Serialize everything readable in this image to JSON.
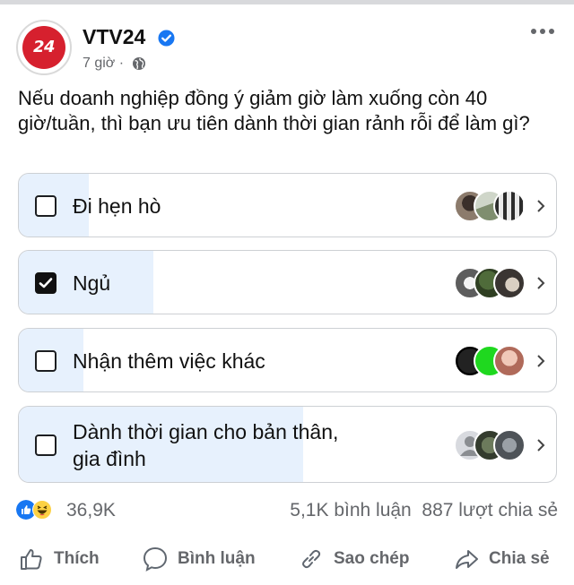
{
  "post": {
    "page_name": "VTV24",
    "avatar_label": "24",
    "time": "7 giờ",
    "separator": "·",
    "text": "Nếu doanh nghiệp đồng ý giảm giờ làm xuống còn 40 giờ/tuần, thì bạn ưu tiên dành thời gian rảnh rỗi để làm gì?"
  },
  "poll": {
    "options": [
      {
        "label": "Đi hẹn hò",
        "checked": false,
        "share": 0.13
      },
      {
        "label": "Ngủ",
        "checked": true,
        "share": 0.25
      },
      {
        "label": "Nhận thêm việc khác",
        "checked": false,
        "share": 0.12
      },
      {
        "label": "Dành thời gian cho bản thân,",
        "label_line2": "gia đình",
        "checked": false,
        "share": 0.53
      }
    ]
  },
  "stats": {
    "reactions": "36,9K",
    "comments": "5,1K bình luận",
    "shares": "887 lượt chia sẻ"
  },
  "actions": {
    "like": "Thích",
    "comment": "Bình luận",
    "copy": "Sao chép",
    "share": "Chia sẻ"
  },
  "colors": {
    "brand_red": "#d6202e",
    "verified_blue": "#1877f2",
    "poll_fill": "#e7f1fd",
    "muted_text": "#65676b"
  },
  "icons": [
    "verified-badge-icon",
    "globe-icon",
    "more-options-icon",
    "checkbox-icon",
    "chevron-right-icon",
    "like-reaction-icon",
    "haha-reaction-icon",
    "thumbs-up-icon",
    "comment-bubble-icon",
    "link-icon",
    "share-arrow-icon"
  ]
}
